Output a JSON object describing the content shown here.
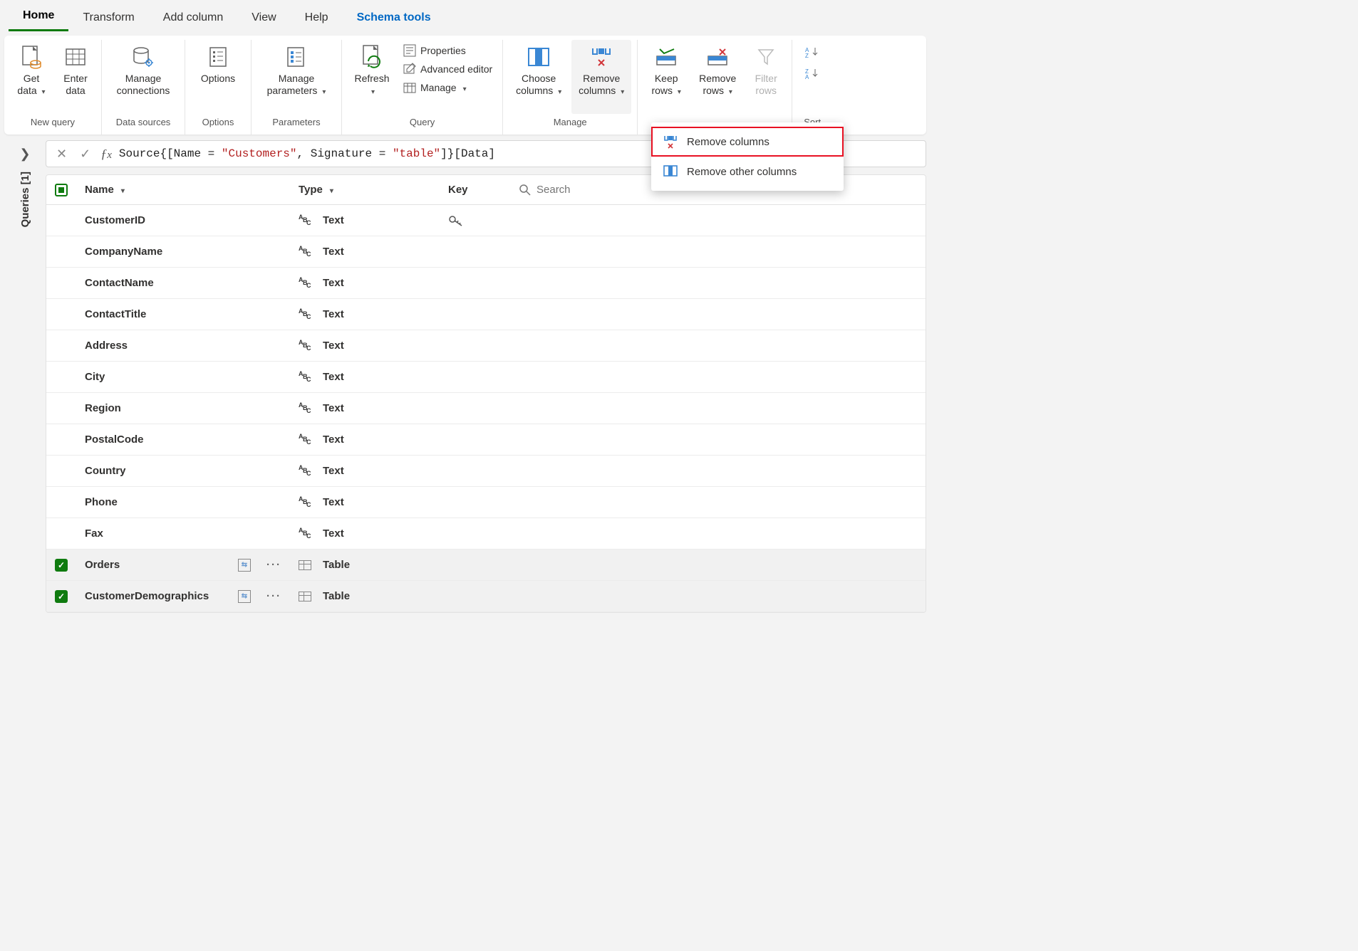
{
  "tabs": [
    "Home",
    "Transform",
    "Add column",
    "View",
    "Help",
    "Schema tools"
  ],
  "ribbon": {
    "new_query": {
      "label": "New query",
      "get_data": "Get data",
      "enter_data": "Enter data"
    },
    "data_sources": {
      "label": "Data sources",
      "manage_connections": "Manage connections"
    },
    "options": {
      "label": "Options",
      "options": "Options"
    },
    "parameters": {
      "label": "Parameters",
      "manage_parameters": "Manage parameters"
    },
    "query": {
      "label": "Query",
      "refresh": "Refresh",
      "properties": "Properties",
      "advanced_editor": "Advanced editor",
      "manage": "Manage"
    },
    "manage_columns": {
      "label": "Manage",
      "choose_columns": "Choose columns",
      "remove_columns": "Remove columns"
    },
    "rows": {
      "keep_rows": "Keep rows",
      "remove_rows": "Remove rows",
      "filter_rows": "Filter rows"
    },
    "sort": {
      "label": "Sort"
    }
  },
  "dropdown": {
    "remove_columns": "Remove columns",
    "remove_other_columns": "Remove other columns"
  },
  "sidebar": {
    "queries_label": "Queries [1]"
  },
  "formula": {
    "p1": "Source{[Name = ",
    "s1": "\"Customers\"",
    "p2": ", Signature = ",
    "s2": "\"table\"",
    "p3": "]}[Data]"
  },
  "grid": {
    "headers": {
      "name": "Name",
      "type": "Type",
      "key": "Key",
      "search_placeholder": "Search"
    },
    "rows": [
      {
        "name": "CustomerID",
        "type": "Text",
        "key": true,
        "selected": false,
        "nav": false
      },
      {
        "name": "CompanyName",
        "type": "Text",
        "key": false,
        "selected": false,
        "nav": false
      },
      {
        "name": "ContactName",
        "type": "Text",
        "key": false,
        "selected": false,
        "nav": false
      },
      {
        "name": "ContactTitle",
        "type": "Text",
        "key": false,
        "selected": false,
        "nav": false
      },
      {
        "name": "Address",
        "type": "Text",
        "key": false,
        "selected": false,
        "nav": false
      },
      {
        "name": "City",
        "type": "Text",
        "key": false,
        "selected": false,
        "nav": false
      },
      {
        "name": "Region",
        "type": "Text",
        "key": false,
        "selected": false,
        "nav": false
      },
      {
        "name": "PostalCode",
        "type": "Text",
        "key": false,
        "selected": false,
        "nav": false
      },
      {
        "name": "Country",
        "type": "Text",
        "key": false,
        "selected": false,
        "nav": false
      },
      {
        "name": "Phone",
        "type": "Text",
        "key": false,
        "selected": false,
        "nav": false
      },
      {
        "name": "Fax",
        "type": "Text",
        "key": false,
        "selected": false,
        "nav": false
      },
      {
        "name": "Orders",
        "type": "Table",
        "key": false,
        "selected": true,
        "nav": true
      },
      {
        "name": "CustomerDemographics",
        "type": "Table",
        "key": false,
        "selected": true,
        "nav": true
      }
    ]
  }
}
